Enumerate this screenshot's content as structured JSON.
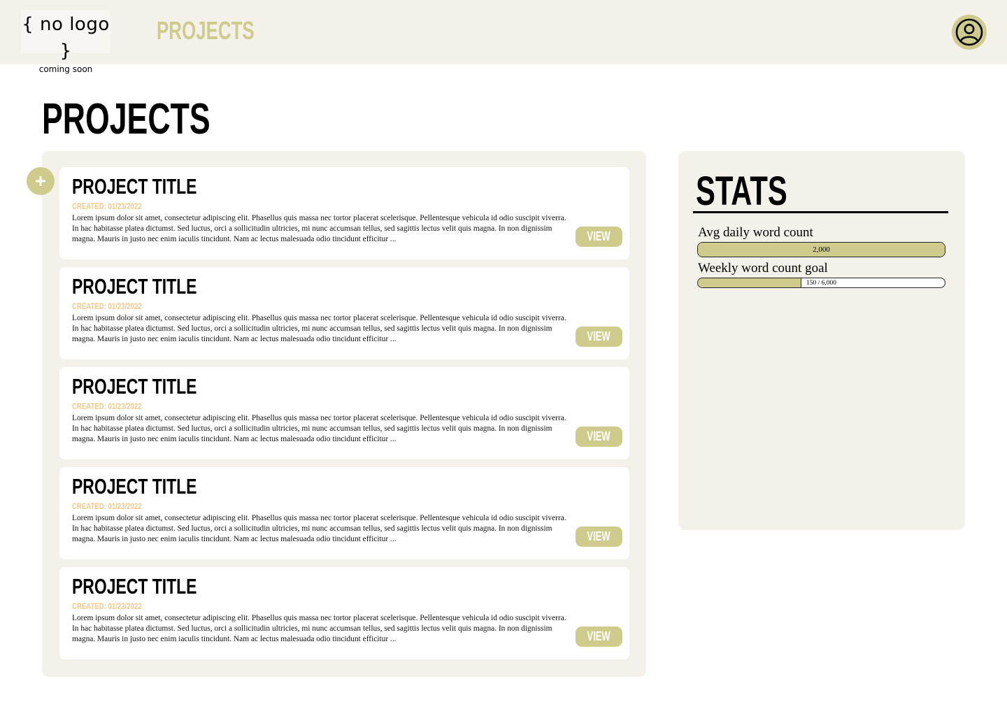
{
  "header": {
    "logo_main": "{ no logo }",
    "logo_sub": "coming soon",
    "nav_title": "PROJECTS"
  },
  "page": {
    "title": "PROJECTS"
  },
  "projects": [
    {
      "title": "PROJECT TITLE",
      "created": "CREATED: 01/23/2022",
      "description": "Lorem ipsum dolor sit amet, consectetur adipiscing elit. Phasellus quis massa nec tortor placerat scelerisque. Pellentesque vehicula id odio suscipit viverra. In hac habitasse platea dictumst. Sed luctus, orci a sollicitudin ultricies, mi nunc accumsan tellus, sed sagittis lectus velit quis magna. In non dignissim magna. Mauris in justo nec enim iaculis tincidunt. Nam ac lectus malesuada odio tincidunt efficitur ...",
      "view_label": "VIEW"
    },
    {
      "title": "PROJECT TITLE",
      "created": "CREATED: 01/23/2022",
      "description": "Lorem ipsum dolor sit amet, consectetur adipiscing elit. Phasellus quis massa nec tortor placerat scelerisque. Pellentesque vehicula id odio suscipit viverra. In hac habitasse platea dictumst. Sed luctus, orci a sollicitudin ultricies, mi nunc accumsan tellus, sed sagittis lectus velit quis magna. In non dignissim magna. Mauris in justo nec enim iaculis tincidunt. Nam ac lectus malesuada odio tincidunt efficitur ...",
      "view_label": "VIEW"
    },
    {
      "title": "PROJECT TITLE",
      "created": "CREATED: 01/23/2022",
      "description": "Lorem ipsum dolor sit amet, consectetur adipiscing elit. Phasellus quis massa nec tortor placerat scelerisque. Pellentesque vehicula id odio suscipit viverra. In hac habitasse platea dictumst. Sed luctus, orci a sollicitudin ultricies, mi nunc accumsan tellus, sed sagittis lectus velit quis magna. In non dignissim magna. Mauris in justo nec enim iaculis tincidunt. Nam ac lectus malesuada odio tincidunt efficitur ...",
      "view_label": "VIEW"
    },
    {
      "title": "PROJECT TITLE",
      "created": "CREATED: 01/23/2022",
      "description": "Lorem ipsum dolor sit amet, consectetur adipiscing elit. Phasellus quis massa nec tortor placerat scelerisque. Pellentesque vehicula id odio suscipit viverra. In hac habitasse platea dictumst. Sed luctus, orci a sollicitudin ultricies, mi nunc accumsan tellus, sed sagittis lectus velit quis magna. In non dignissim magna. Mauris in justo nec enim iaculis tincidunt. Nam ac lectus malesuada odio tincidunt efficitur ...",
      "view_label": "VIEW"
    },
    {
      "title": "PROJECT TITLE",
      "created": "CREATED: 01/23/2022",
      "description": "Lorem ipsum dolor sit amet, consectetur adipiscing elit. Phasellus quis massa nec tortor placerat scelerisque. Pellentesque vehicula id odio suscipit viverra. In hac habitasse platea dictumst. Sed luctus, orci a sollicitudin ultricies, mi nunc accumsan tellus, sed sagittis lectus velit quis magna. In non dignissim magna. Mauris in justo nec enim iaculis tincidunt. Nam ac lectus malesuada odio tincidunt efficitur ...",
      "view_label": "VIEW"
    }
  ],
  "stats": {
    "title": "STATS",
    "avg_daily": {
      "label": "Avg daily word count",
      "value_text": "2,000",
      "fill_fraction": 1.0
    },
    "weekly_goal": {
      "label": "Weekly word count goal",
      "value_text": "150 / 6,000",
      "fill_fraction": 0.42
    }
  },
  "colors": {
    "accent": "#cfcb8c",
    "panel_bg": "#f3f1ea",
    "date_text": "#f0c98a"
  },
  "icons": {
    "avatar": "user-circle-icon",
    "add": "plus-icon"
  }
}
